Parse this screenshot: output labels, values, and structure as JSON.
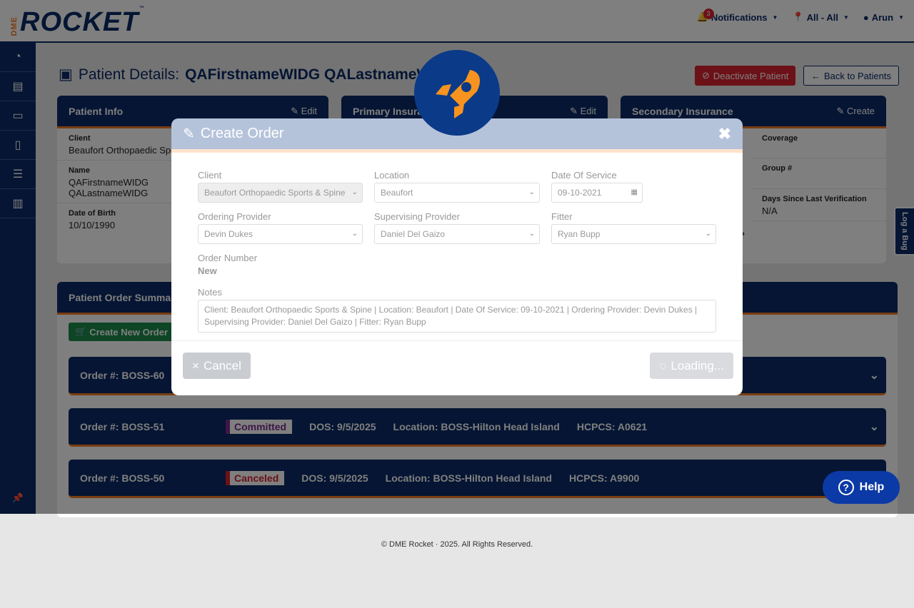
{
  "brand": {
    "prefix": "DME",
    "name": "ROCKET",
    "tm": "™"
  },
  "nav": {
    "notifications_label": "Notifications",
    "notifications_count": "3",
    "location_label": "All - All",
    "user_label": "Arun"
  },
  "page": {
    "title_prefix": "Patient Details:",
    "patient_name": "QAFirstnameWIDG QALastnameWIDG",
    "deactivate_label": "Deactivate Patient",
    "back_label": "Back to Patients"
  },
  "patient_info": {
    "header": "Patient Info",
    "edit_label": "Edit",
    "client_label": "Client",
    "client_value": "Beaufort Orthopaedic Sports & Spine",
    "name_label": "Name",
    "first_name": "QAFirstnameWIDG",
    "last_name": "QALastnameWIDG",
    "dob_label": "Date of Birth",
    "dob_value": "10/10/1990"
  },
  "primary_insurance": {
    "header": "Primary Insurance",
    "edit_label": "Edit"
  },
  "secondary_insurance": {
    "header": "Secondary Insurance",
    "create_label": "Create",
    "coverage_label": "Coverage",
    "group_label": "Group #",
    "days_label": "Days Since Last Verification",
    "days_value": "N/A",
    "partial_label": "r?"
  },
  "order_summary": {
    "header": "Patient Order Summary",
    "create_label": "Create New Order",
    "orders": [
      {
        "number": "Order #: BOSS-60"
      },
      {
        "number": "Order #: BOSS-51",
        "status": "Committed",
        "dos": "DOS: 9/5/2025",
        "location": "Location: BOSS-Hilton Head Island",
        "hcpcs": "HCPCS: A0621",
        "status_color": "#7b2c8f"
      },
      {
        "number": "Order #: BOSS-50",
        "status": "Canceled",
        "dos": "DOS: 9/5/2025",
        "location": "Location: BOSS-Hilton Head Island",
        "hcpcs": "HCPCS: A9900",
        "status_color": "#d9232e"
      }
    ]
  },
  "modal": {
    "title": "Create Order",
    "client_label": "Client",
    "client_value": "Beaufort Orthopaedic Sports & Spine",
    "location_label": "Location",
    "location_value": "Beaufort",
    "dos_label": "Date Of Service",
    "dos_value": "09-10-2021",
    "ordering_label": "Ordering Provider",
    "ordering_value": "Devin Dukes",
    "supervising_label": "Supervising Provider",
    "supervising_value": "Daniel Del Gaizo",
    "fitter_label": "Fitter",
    "fitter_value": "Ryan Bupp",
    "order_number_label": "Order Number",
    "order_number_value": "New",
    "notes_label": "Notes",
    "notes_value": "Client: Beaufort Orthopaedic Sports & Spine | Location: Beaufort | Date Of Service: 09-10-2021 | Ordering Provider: Devin Dukes | Supervising Provider: Daniel Del Gaizo | Fitter: Ryan Bupp",
    "cancel_label": "Cancel",
    "loading_label": "Loading..."
  },
  "footer": {
    "text": "© DME Rocket  ·  2025. All Rights Reserved."
  },
  "log_bug_label": "Log a Bug",
  "help_label": "Help",
  "colors": {
    "primary": "#0b2a66",
    "accent": "#f47b20",
    "danger": "#d9232e",
    "success": "#1a8a4a"
  }
}
